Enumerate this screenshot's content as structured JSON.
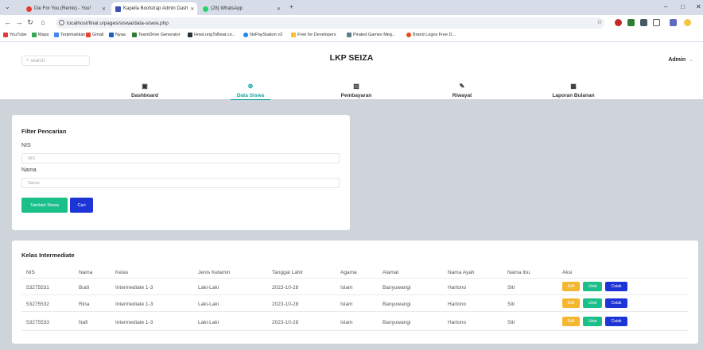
{
  "browser": {
    "tabs": [
      {
        "label": "Die For You (Remix) - You!",
        "favicon_color": "#e53935"
      },
      {
        "label": "Kapella Bootstrap Admin Dash",
        "favicon_color": "#3f51b5"
      },
      {
        "label": "(28) WhatsApp",
        "favicon_color": "#25d366"
      }
    ],
    "new_tab": "+",
    "url": "localhost/final.u/pages/siswa/data-siswa.php",
    "bookmarks": [
      {
        "label": "YouTube",
        "color": "#e53935"
      },
      {
        "label": "Maps",
        "color": "#34a853"
      },
      {
        "label": "Terjemahkan",
        "color": "#4285f4"
      },
      {
        "label": "Gmail",
        "color": "#ea4335"
      },
      {
        "label": "Nyaa",
        "color": "#1565c0"
      },
      {
        "label": "TeamDrive Generator",
        "color": "#2e7d32"
      },
      {
        "label": "HowLongToBeat.co...",
        "color": "#263238"
      },
      {
        "label": "NoPayStation v3",
        "color": "#1e88e5"
      },
      {
        "label": "Free for Developers",
        "color": "#fbc02d"
      },
      {
        "label": "Pirated Games Meg...",
        "color": "#607d8b"
      },
      {
        "label": "Brand Logos Free D...",
        "color": "#e64a19"
      }
    ]
  },
  "header": {
    "search_placeholder": "search",
    "brand": "LKP SEIZA",
    "user": "Admin",
    "menu": [
      {
        "label": "Dashboard",
        "icon": "dashboard-icon",
        "glyph": "▣",
        "active": false
      },
      {
        "label": "Data Siswa",
        "icon": "globe-icon",
        "glyph": "⊕",
        "active": true
      },
      {
        "label": "Pembayaran",
        "icon": "image-icon",
        "glyph": "▨",
        "active": false
      },
      {
        "label": "Riwayat",
        "icon": "pen-icon",
        "glyph": "✎",
        "active": false
      },
      {
        "label": "Laporan Bulanan",
        "icon": "table-icon",
        "glyph": "▦",
        "active": false
      }
    ]
  },
  "filter": {
    "title": "Filter Pencarian",
    "nis_label": "NIS",
    "nis_placeholder": "NIS",
    "nama_label": "Nama",
    "nama_placeholder": "Nama",
    "add_button": "Tambah Siswa",
    "search_button": "Cari"
  },
  "table": {
    "title": "Kelas Intermediate",
    "headers": [
      "NIS",
      "Nama",
      "Kelas",
      "Jenis Kelamin",
      "Tanggal Lahir",
      "Agama",
      "Alamat",
      "Nama Ayah",
      "Nama Ibu",
      "Aksi"
    ],
    "rows": [
      [
        "53275531",
        "Budi",
        "Intermediate 1-3",
        "Laki-Laki",
        "2023-10-28",
        "Islam",
        "Banyuwangi",
        "Hartono",
        "Siti"
      ],
      [
        "53275532",
        "Rina",
        "Intermediate 1-3",
        "Laki-Laki",
        "2023-10-28",
        "Islam",
        "Banyuwangi",
        "Hartono",
        "Siti"
      ],
      [
        "53275533",
        "Nafi",
        "Intermediate 1-3",
        "Laki-Laki",
        "2023-10-28",
        "Islam",
        "Banyuwangi",
        "Hartono",
        "Siti"
      ]
    ],
    "actions": {
      "edit": "Edit",
      "view": "Lihat",
      "print": "Cetak"
    }
  },
  "colors": {
    "accent": "#16a3a3",
    "green": "#1bbf8a",
    "blue": "#1d34d6",
    "yellow": "#f5b730"
  }
}
